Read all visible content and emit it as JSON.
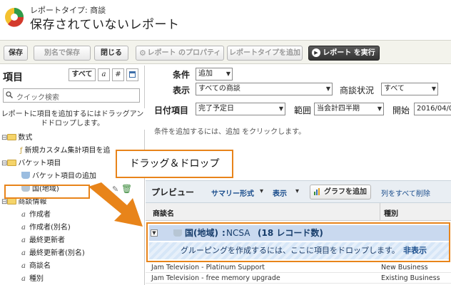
{
  "header": {
    "subtitle": "レポートタイプ: 商談",
    "title": "保存されていないレポート"
  },
  "toolbar": {
    "save": "保存",
    "save_as": "別名で保存",
    "close": "閉じる",
    "properties": "レポート のプロパティ",
    "add_report_type": "レポートタイプを追加",
    "run_report": "レポート を実行"
  },
  "left_panel": {
    "heading": "項目",
    "filter_tabs": [
      "すべて",
      "a",
      "#"
    ],
    "search_placeholder": "クイック検索",
    "hint": "レポートに項目を追加するにはドラッグアンドドロップします。",
    "tree": [
      {
        "label": "数式",
        "type": "folder"
      },
      {
        "label": "新規カスタム集計項目を追",
        "type": "formula"
      },
      {
        "label": "バケット項目",
        "type": "folder"
      },
      {
        "label": "バケット項目の追加",
        "type": "bucket-add"
      },
      {
        "label": "国(地域)",
        "type": "bucket"
      },
      {
        "label": "商談情報",
        "type": "folder"
      },
      {
        "label": "作成者",
        "type": "field"
      },
      {
        "label": "作成者(別名)",
        "type": "field"
      },
      {
        "label": "最終更新者",
        "type": "field"
      },
      {
        "label": "最終更新者(別名)",
        "type": "field"
      },
      {
        "label": "商談名",
        "type": "field"
      },
      {
        "label": "種別",
        "type": "field"
      }
    ]
  },
  "filters": {
    "conditions_label": "条件",
    "add_label": "追加",
    "display_label": "表示",
    "display_value": "すべての商談",
    "status_label": "商談状況",
    "status_value": "すべて",
    "date_label": "日付項目",
    "date_value": "完了予定日",
    "range_label": "範囲",
    "range_value": "当会計四半期",
    "start_label": "開始",
    "start_value": "2016/04/0",
    "conditions_hint": "条件を追加するには、追加 をクリックします。"
  },
  "preview": {
    "label": "プレビュー",
    "summary_format": "サマリー形式",
    "show": "表示",
    "add_chart": "グラフを追加",
    "remove_all_columns": "列をすべて削除"
  },
  "table": {
    "columns": [
      "商談名",
      "種別"
    ],
    "group": {
      "label": "国(地域)",
      "value": "NCSA",
      "count": "(18 レコード数)"
    },
    "drop_hint": "グルーピングを作成するには、ここに項目をドロップします。",
    "hide": "非表示",
    "rows": [
      [
        "Jam Television - Platinum Support",
        "New Business"
      ],
      [
        "Jam Television - free memory upgrade",
        "Existing Business"
      ]
    ]
  },
  "callout": {
    "text": "ドラッグ＆ドロップ"
  }
}
